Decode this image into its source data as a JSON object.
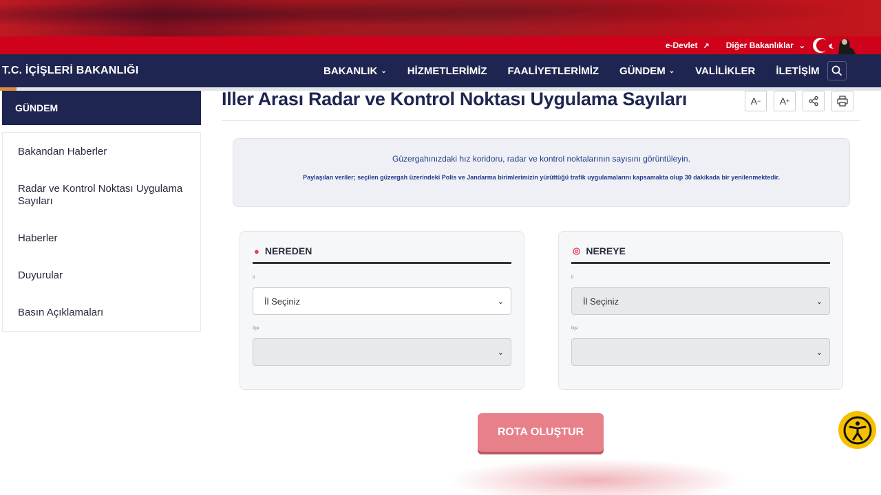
{
  "topbar": {
    "edevlet": "e-Devlet",
    "other_ministries": "Diğer Bakanlıklar"
  },
  "nav": {
    "brand": "T.C. İÇİŞLERİ BAKANLIĞI",
    "items": [
      {
        "label": "BAKANLIK",
        "has_dropdown": true
      },
      {
        "label": "HİZMETLERİMİZ",
        "has_dropdown": false
      },
      {
        "label": "FAALİYETLERİMİZ",
        "has_dropdown": false
      },
      {
        "label": "GÜNDEM",
        "has_dropdown": true
      },
      {
        "label": "VALİLİKLER",
        "has_dropdown": false
      },
      {
        "label": "İLETİŞİM",
        "has_dropdown": false
      }
    ]
  },
  "sidebar": {
    "title": "GÜNDEM",
    "items": [
      {
        "label": "Bakandan Haberler"
      },
      {
        "label": "Radar ve Kontrol Noktası Uygulama Sayıları"
      },
      {
        "label": "Haberler"
      },
      {
        "label": "Duyurular"
      },
      {
        "label": "Basın Açıklamaları"
      }
    ]
  },
  "page": {
    "title": "Iller Arası Radar ve Kontrol Noktası Uygulama Sayıları",
    "tools": {
      "font_decrease": "A",
      "font_increase": "A"
    }
  },
  "info": {
    "line1": "Güzergahınızdaki hız koridoru, radar ve kontrol noktalarının sayısını görüntüleyin.",
    "line2": "Paylaşılan veriler; seçilen güzergah üzerindeki Polis ve Jandarma birimlerimizin yürüttüğü trafik uygulamalarını kapsamakta olup 30 dakikada bir yenilenmektedir."
  },
  "from_card": {
    "heading": "NEREDEN",
    "province_label": "İl",
    "province_value": "İl Seçiniz",
    "district_label": "İlçe",
    "district_value": ""
  },
  "to_card": {
    "heading": "NEREYE",
    "province_label": "İl",
    "province_value": "İl Seçiniz",
    "district_label": "İlçe",
    "district_value": ""
  },
  "route_button": "ROTA OLUŞTUR",
  "colors": {
    "navy": "#1e2550",
    "red": "#d0021b",
    "button": "#e8808a",
    "accessibility": "#f5c000"
  }
}
